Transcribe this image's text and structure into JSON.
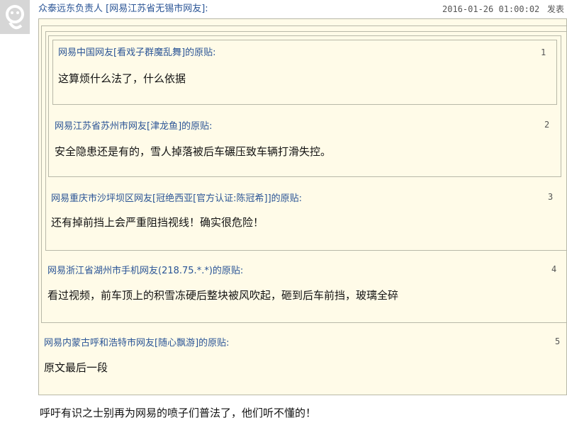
{
  "post": {
    "author": "众泰远东负责人",
    "location": "[网易江苏省无锡市网友]:",
    "time": "2016-01-26 01:00:02",
    "action": "发表"
  },
  "quotes": [
    {
      "header": "网易浙江省湖州市手机网友(218.75.*.*)的原贴:",
      "floor": "4",
      "text": "看过视频，前车顶上的积雪冻硬后整块被风吹起，砸到后车前挡，玻璃全碎"
    },
    {
      "header": "网易内蒙古呼和浩特市网友[随心飘游]的原贴:",
      "floor": "5",
      "text": "原文最后一段"
    },
    {
      "header": "网易重庆市沙坪坝区网友[冠绝西亚[官方认证:陈冠希]]的原贴:",
      "floor": "3",
      "text": "还有掉前挡上会严重阻挡视线！确实很危险！"
    },
    {
      "header": "网易江苏省苏州市网友[津龙鱼]的原贴:",
      "floor": "2",
      "text": "安全隐患还是有的，雪人掉落被后车碾压致车辆打滑失控。"
    },
    {
      "header": "网易中国网友[看戏子群魔乱舞]的原贴:",
      "floor": "1",
      "text": "这算烦什么法了，什么依据"
    }
  ],
  "reply": {
    "text": "呼吁有识之士别再为网易的喷子们普法了，他们听不懂的！"
  }
}
